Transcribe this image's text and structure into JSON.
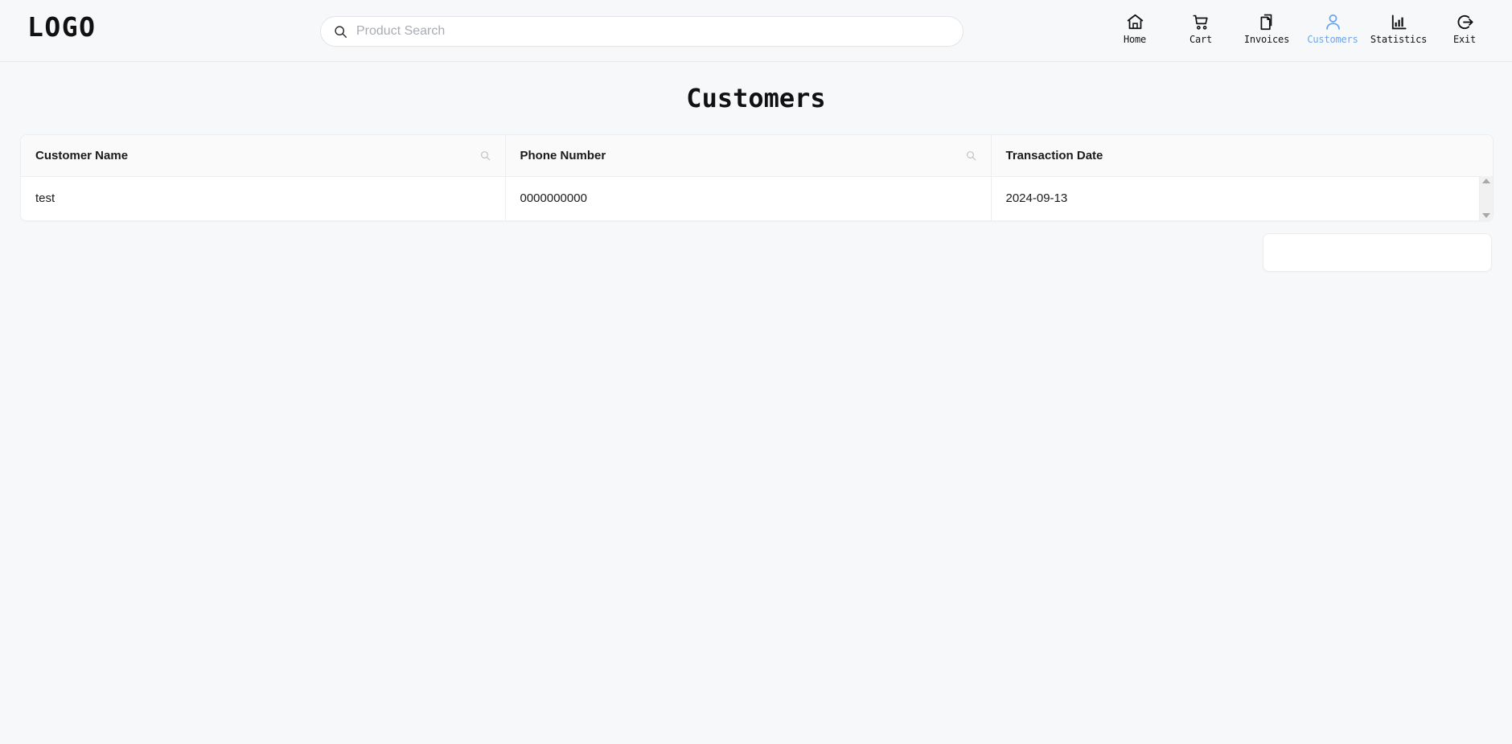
{
  "brand": {
    "logo_text": "LOGO"
  },
  "search": {
    "placeholder": "Product Search",
    "value": "",
    "icon": "search-icon"
  },
  "nav": {
    "active": "Customers",
    "active_color": "#6ba5f0",
    "items": [
      {
        "label": "Home",
        "icon": "home-icon"
      },
      {
        "label": "Cart",
        "icon": "cart-icon"
      },
      {
        "label": "Invoices",
        "icon": "documents-icon"
      },
      {
        "label": "Customers",
        "icon": "person-icon"
      },
      {
        "label": "Statistics",
        "icon": "bar-chart-icon"
      },
      {
        "label": "Exit",
        "icon": "exit-icon"
      }
    ]
  },
  "page": {
    "title": "Customers"
  },
  "table": {
    "columns": [
      {
        "header": "Customer Name",
        "filterable": true,
        "filter_icon": "search-icon"
      },
      {
        "header": "Phone Number",
        "filterable": true,
        "filter_icon": "search-icon"
      },
      {
        "header": "Transaction Date",
        "filterable": false,
        "filter_icon": ""
      }
    ],
    "rows": [
      {
        "customer_name": "test",
        "phone_number": "0000000000",
        "transaction_date": "2024-09-13"
      }
    ],
    "scrollbar": {
      "up_arrow": "scroll-up-icon",
      "down_arrow": "scroll-down-icon"
    }
  },
  "side_panel": {
    "content": ""
  },
  "colors": {
    "page_background": "#f7f8fa",
    "surface": "#ffffff",
    "header_row": "#fafafa",
    "border": "#ededef",
    "text": "#1b1b1b",
    "muted_text": "#a9acb2",
    "accent": "#6ba5f0"
  }
}
